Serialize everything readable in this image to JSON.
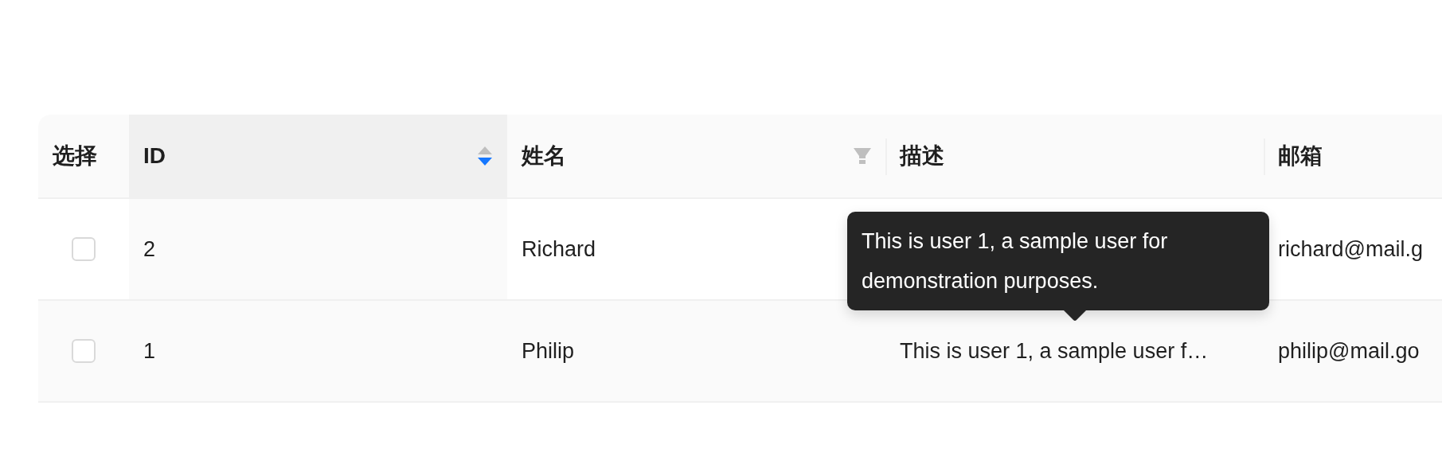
{
  "table": {
    "columns": [
      {
        "label": "选择",
        "kind": "select"
      },
      {
        "label": "ID",
        "kind": "sort",
        "sorted": true,
        "descending": true
      },
      {
        "label": "姓名",
        "kind": "filter",
        "filtered": false
      },
      {
        "label": "描述",
        "kind": "plain"
      },
      {
        "label": "邮箱",
        "kind": "plain"
      }
    ],
    "rows": [
      {
        "checked": false,
        "id": "2",
        "name": "Richard",
        "email": "richard@mail.g"
      },
      {
        "checked": false,
        "id": "1",
        "name": "Philip",
        "description": "This is user 1, a sample user f…",
        "email": "philip@mail.go",
        "tooltip": "This is user 1, a sample user for demonstration purposes."
      }
    ]
  }
}
